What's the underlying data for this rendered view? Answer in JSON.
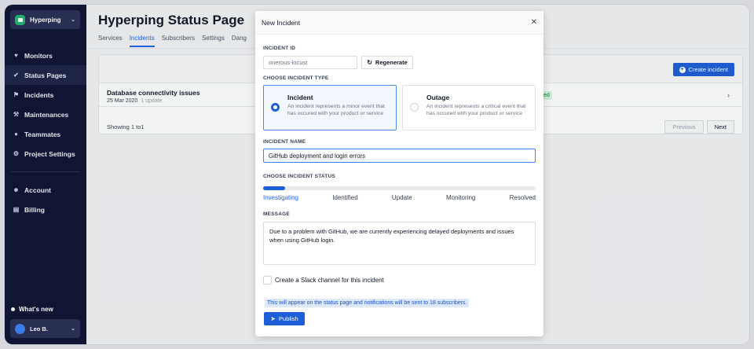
{
  "sidebar": {
    "project_name": "Hyperping",
    "items": [
      {
        "label": "Monitors",
        "icon": "heart-icon"
      },
      {
        "label": "Status Pages",
        "icon": "check-circle-icon"
      },
      {
        "label": "Incidents",
        "icon": "megaphone-icon"
      },
      {
        "label": "Maintenances",
        "icon": "wrench-icon"
      },
      {
        "label": "Teammates",
        "icon": "users-icon"
      },
      {
        "label": "Project Settings",
        "icon": "gear-icon"
      }
    ],
    "account_items": [
      {
        "label": "Account",
        "icon": "user-icon"
      },
      {
        "label": "Billing",
        "icon": "card-icon"
      }
    ],
    "whats_new": "What's new",
    "user_name": "Leo B."
  },
  "main": {
    "title": "Hyperping Status Page",
    "tabs": [
      "Services",
      "Incidents",
      "Subscribers",
      "Settings",
      "Dang"
    ],
    "create_button": "Create incident",
    "incident": {
      "name": "Database connectivity issues",
      "date": "25 Mar 2020",
      "updates": "1 update",
      "badge": "ed"
    },
    "showing": "Showing 1 to1",
    "previous": "Previous",
    "next": "Next"
  },
  "modal": {
    "title": "New Incident",
    "incident_id_label": "INCIDENT ID",
    "incident_id_value": "onerous-locust",
    "regenerate": "Regenerate",
    "type_label": "CHOOSE INCIDENT TYPE",
    "types": [
      {
        "title": "Incident",
        "desc": "An incident represents a minor event that has occured with your product or service",
        "selected": true
      },
      {
        "title": "Outage",
        "desc": "An incident represents a critical event that has occured with your product or service",
        "selected": false
      }
    ],
    "name_label": "INCIDENT NAME",
    "name_value": "GitHub deployment and login errors",
    "status_label": "CHOOSE INCIDENT STATUS",
    "statuses": [
      "Investigating",
      "Identified",
      "Update",
      "Monitoring",
      "Resolved"
    ],
    "status_selected": "Investigating",
    "status_progress": 0.08,
    "message_label": "MESSAGE",
    "message_value": "Due to a problem with GitHub, we are currently experiencing delayed deployments and issues when using GitHub login.",
    "slack_label": "Create a Slack channel for this incident",
    "note": "This will appear on the status page and notifications will be sent to 18 subscribers.",
    "publish": "Publish"
  }
}
